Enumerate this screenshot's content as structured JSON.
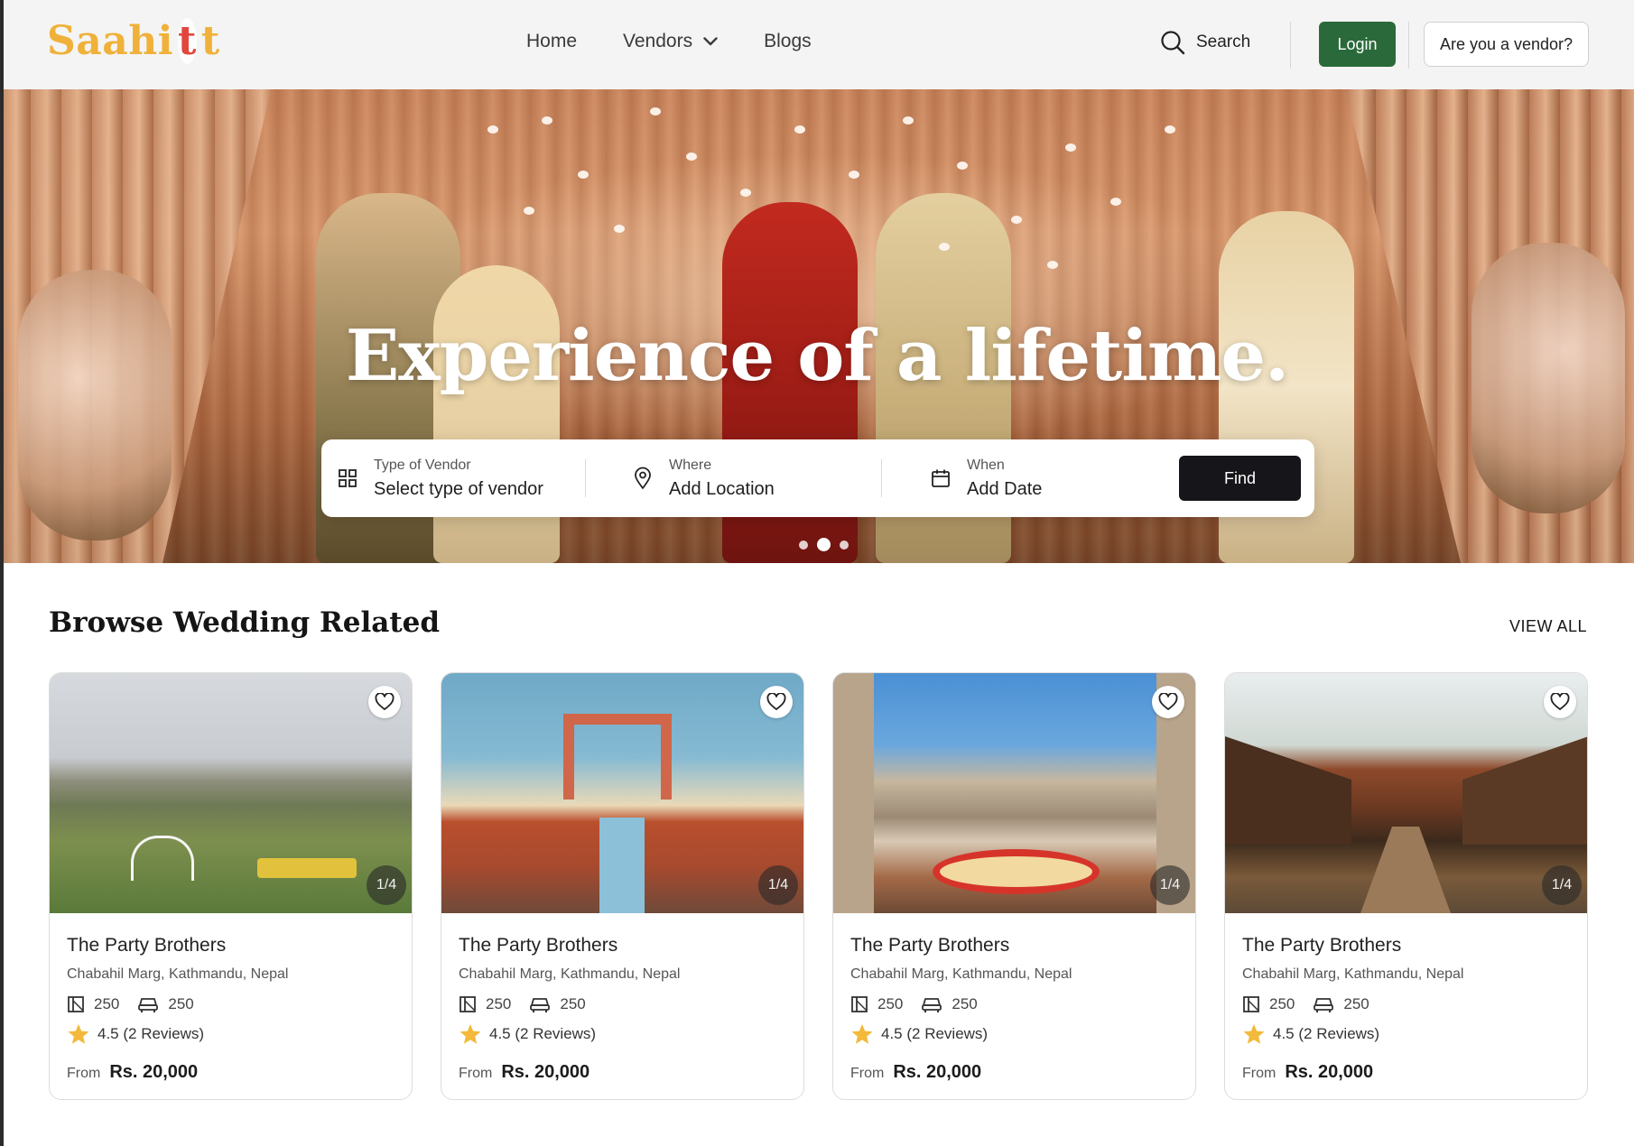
{
  "brand": {
    "name_start": "Saahi",
    "name_dot": "t",
    "name_end": "t",
    "color": "#f0b13a",
    "dot_color": "#e2463c"
  },
  "nav": {
    "home": "Home",
    "vendors": "Vendors",
    "blogs": "Blogs"
  },
  "header": {
    "search_label": "Search",
    "login_label": "Login",
    "vendor_label": "Are you a vendor?",
    "login_color": "#2a6a3a"
  },
  "hero": {
    "title": "Experience of a lifetime.",
    "search": {
      "vendor_type_label": "Type of Vendor",
      "vendor_type_value": "Select type of vendor",
      "where_label": "Where",
      "where_value": "Add Location",
      "when_label": "When",
      "when_value": "Add Date",
      "find_label": "Find"
    },
    "carousel": {
      "slides": 3,
      "active_slide": 2
    }
  },
  "section": {
    "title": "Browse Wedding Related",
    "view_all": "VIEW ALL"
  },
  "cards": [
    {
      "title": "The Party Brothers",
      "address": "Chabahil Marg, Kathmandu, Nepal",
      "rooms": "250",
      "vehicles": "250",
      "rating": "4.5 (2 Reviews)",
      "from_label": "From",
      "price": "Rs. 20,000",
      "counter": "1/4",
      "image": "garden-venue"
    },
    {
      "title": "The Party Brothers",
      "address": "Chabahil Marg, Kathmandu, Nepal",
      "rooms": "250",
      "vehicles": "250",
      "rating": "4.5 (2 Reviews)",
      "from_label": "From",
      "price": "Rs. 20,000",
      "counter": "1/4",
      "image": "beach-floral-aisle"
    },
    {
      "title": "The Party Brothers",
      "address": "Chabahil Marg, Kathmandu, Nepal",
      "rooms": "250",
      "vehicles": "250",
      "rating": "4.5 (2 Reviews)",
      "from_label": "From",
      "price": "Rs. 20,000",
      "counter": "1/4",
      "image": "palace-courtyard"
    },
    {
      "title": "The Party Brothers",
      "address": "Chabahil Marg, Kathmandu, Nepal",
      "rooms": "250",
      "vehicles": "250",
      "rating": "4.5 (2 Reviews)",
      "from_label": "From",
      "price": "Rs. 20,000",
      "counter": "1/4",
      "image": "resort-boardwalk"
    }
  ],
  "icons": {
    "search": "search-icon",
    "chevron": "chevron-down-icon",
    "grid": "grid-icon",
    "pin": "location-pin-icon",
    "calendar": "calendar-icon",
    "heart": "heart-icon",
    "room": "room-icon",
    "car": "car-icon",
    "star": "star-icon"
  },
  "colors": {
    "star": "#f2b93b",
    "find_button": "#15151a"
  }
}
